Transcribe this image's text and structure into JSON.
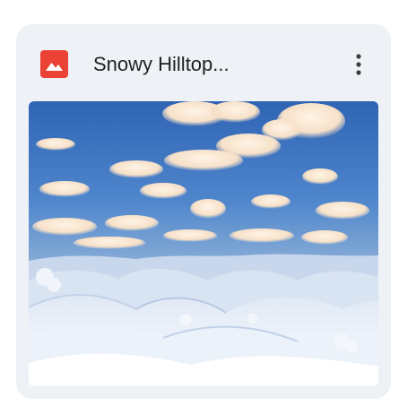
{
  "card": {
    "file_name": "Snowy Hilltop...",
    "file_type_icon": "image-icon",
    "file_type_icon_color": "#ea4335",
    "more_icon": "more-vertical-icon"
  },
  "colors": {
    "card_background": "#eef1f6",
    "title_text": "#1f1f1f",
    "icon_dark": "#3c3c3c"
  }
}
